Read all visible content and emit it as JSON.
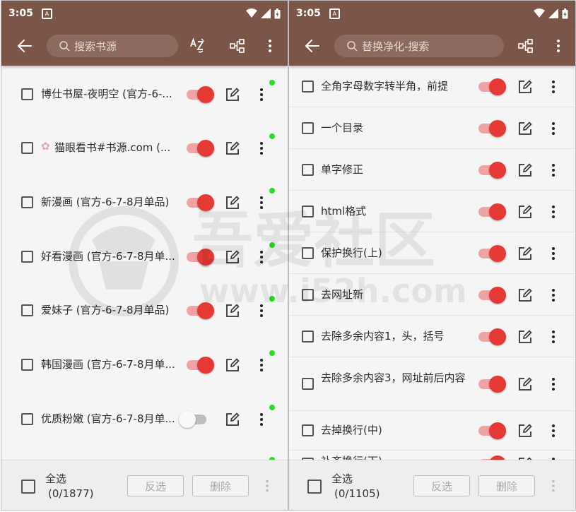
{
  "colors": {
    "primary": "#7b5548",
    "accent": "#e53935",
    "enabled_dot": "#25e01e"
  },
  "status": {
    "time": "3:05"
  },
  "left": {
    "search": {
      "placeholder": "搜索书源"
    },
    "items": [
      {
        "label": "博仕书屋-夜明空 (官方-6-...",
        "enabled": true,
        "dot": true
      },
      {
        "label": "猫眼看书#书源.com (...",
        "enabled": true,
        "dot": true,
        "emoji": "✿"
      },
      {
        "label": "新漫画 (官方-6-7-8月单品)",
        "enabled": true,
        "dot": true
      },
      {
        "label": "好看漫画 (官方-6-7-8月单...",
        "enabled": true,
        "dot": true
      },
      {
        "label": "爱妹子 (官方-6-7-8月单品)",
        "enabled": true,
        "dot": true
      },
      {
        "label": "韩国漫画 (官方-6-7-8月单...",
        "enabled": true,
        "dot": true
      },
      {
        "label": "优质粉嫩 (官方-6-7-8月单...",
        "enabled": false,
        "dot": true
      }
    ],
    "bottom": {
      "select_all": "全选",
      "count": "(0/1877)",
      "invert": "反选",
      "delete": "删除"
    }
  },
  "right": {
    "search": {
      "placeholder": "替换净化-搜索"
    },
    "items": [
      {
        "label": "全角字母数字转半角，前提",
        "enabled": true
      },
      {
        "label": "一个目录",
        "enabled": true
      },
      {
        "label": "单字修正",
        "enabled": true
      },
      {
        "label": "html格式",
        "enabled": true
      },
      {
        "label": "保护换行(上)",
        "enabled": true
      },
      {
        "label": "去网址新",
        "enabled": true
      },
      {
        "label": "去除多余内容1，头，括号",
        "enabled": true
      },
      {
        "label": "去除多余内容3，网址前后内容",
        "enabled": true
      },
      {
        "label": "去掉换行(中)",
        "enabled": true
      },
      {
        "label": "补齐换行(下)",
        "enabled": true
      }
    ],
    "bottom": {
      "select_all": "全选",
      "count": "(0/1105)",
      "invert": "反选",
      "delete": "删除"
    }
  },
  "watermark": {
    "text": "吾爱社区",
    "url": "www.i52h.com"
  }
}
